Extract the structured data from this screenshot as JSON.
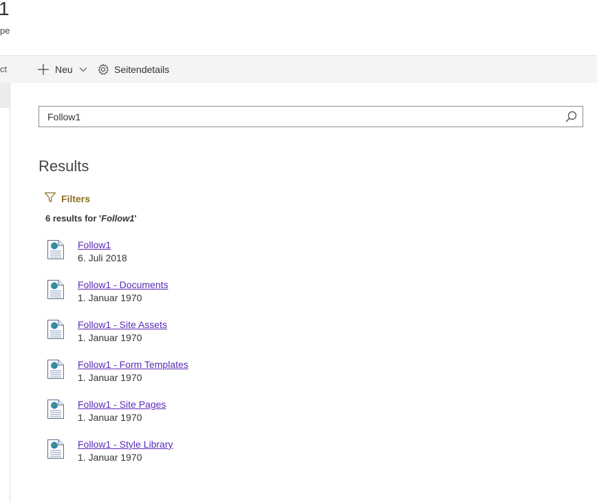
{
  "header": {
    "site_title": "1",
    "site_subtitle": "pe"
  },
  "nav": {
    "cut_label": "ct"
  },
  "command_bar": {
    "new_label": "Neu",
    "details_label": "Seitendetails"
  },
  "search": {
    "value": "Follow1"
  },
  "results": {
    "heading": "Results",
    "filters_label": "Filters",
    "count_prefix": "6 results for '",
    "count_query": "Follow1",
    "count_suffix": "'",
    "items": [
      {
        "title": "Follow1",
        "date": "6. Juli 2018"
      },
      {
        "title": "Follow1 - Documents",
        "date": "1. Januar 1970"
      },
      {
        "title": "Follow1 - Site Assets",
        "date": "1. Januar 1970"
      },
      {
        "title": "Follow1 - Form Templates",
        "date": "1. Januar 1970"
      },
      {
        "title": "Follow1 - Site Pages",
        "date": "1. Januar 1970"
      },
      {
        "title": "Follow1 - Style Library",
        "date": "1. Januar 1970"
      }
    ]
  },
  "colors": {
    "link": "#5a2ab8",
    "filters": "#8c6d1f",
    "command_bar_bg": "#f4f4f4"
  }
}
